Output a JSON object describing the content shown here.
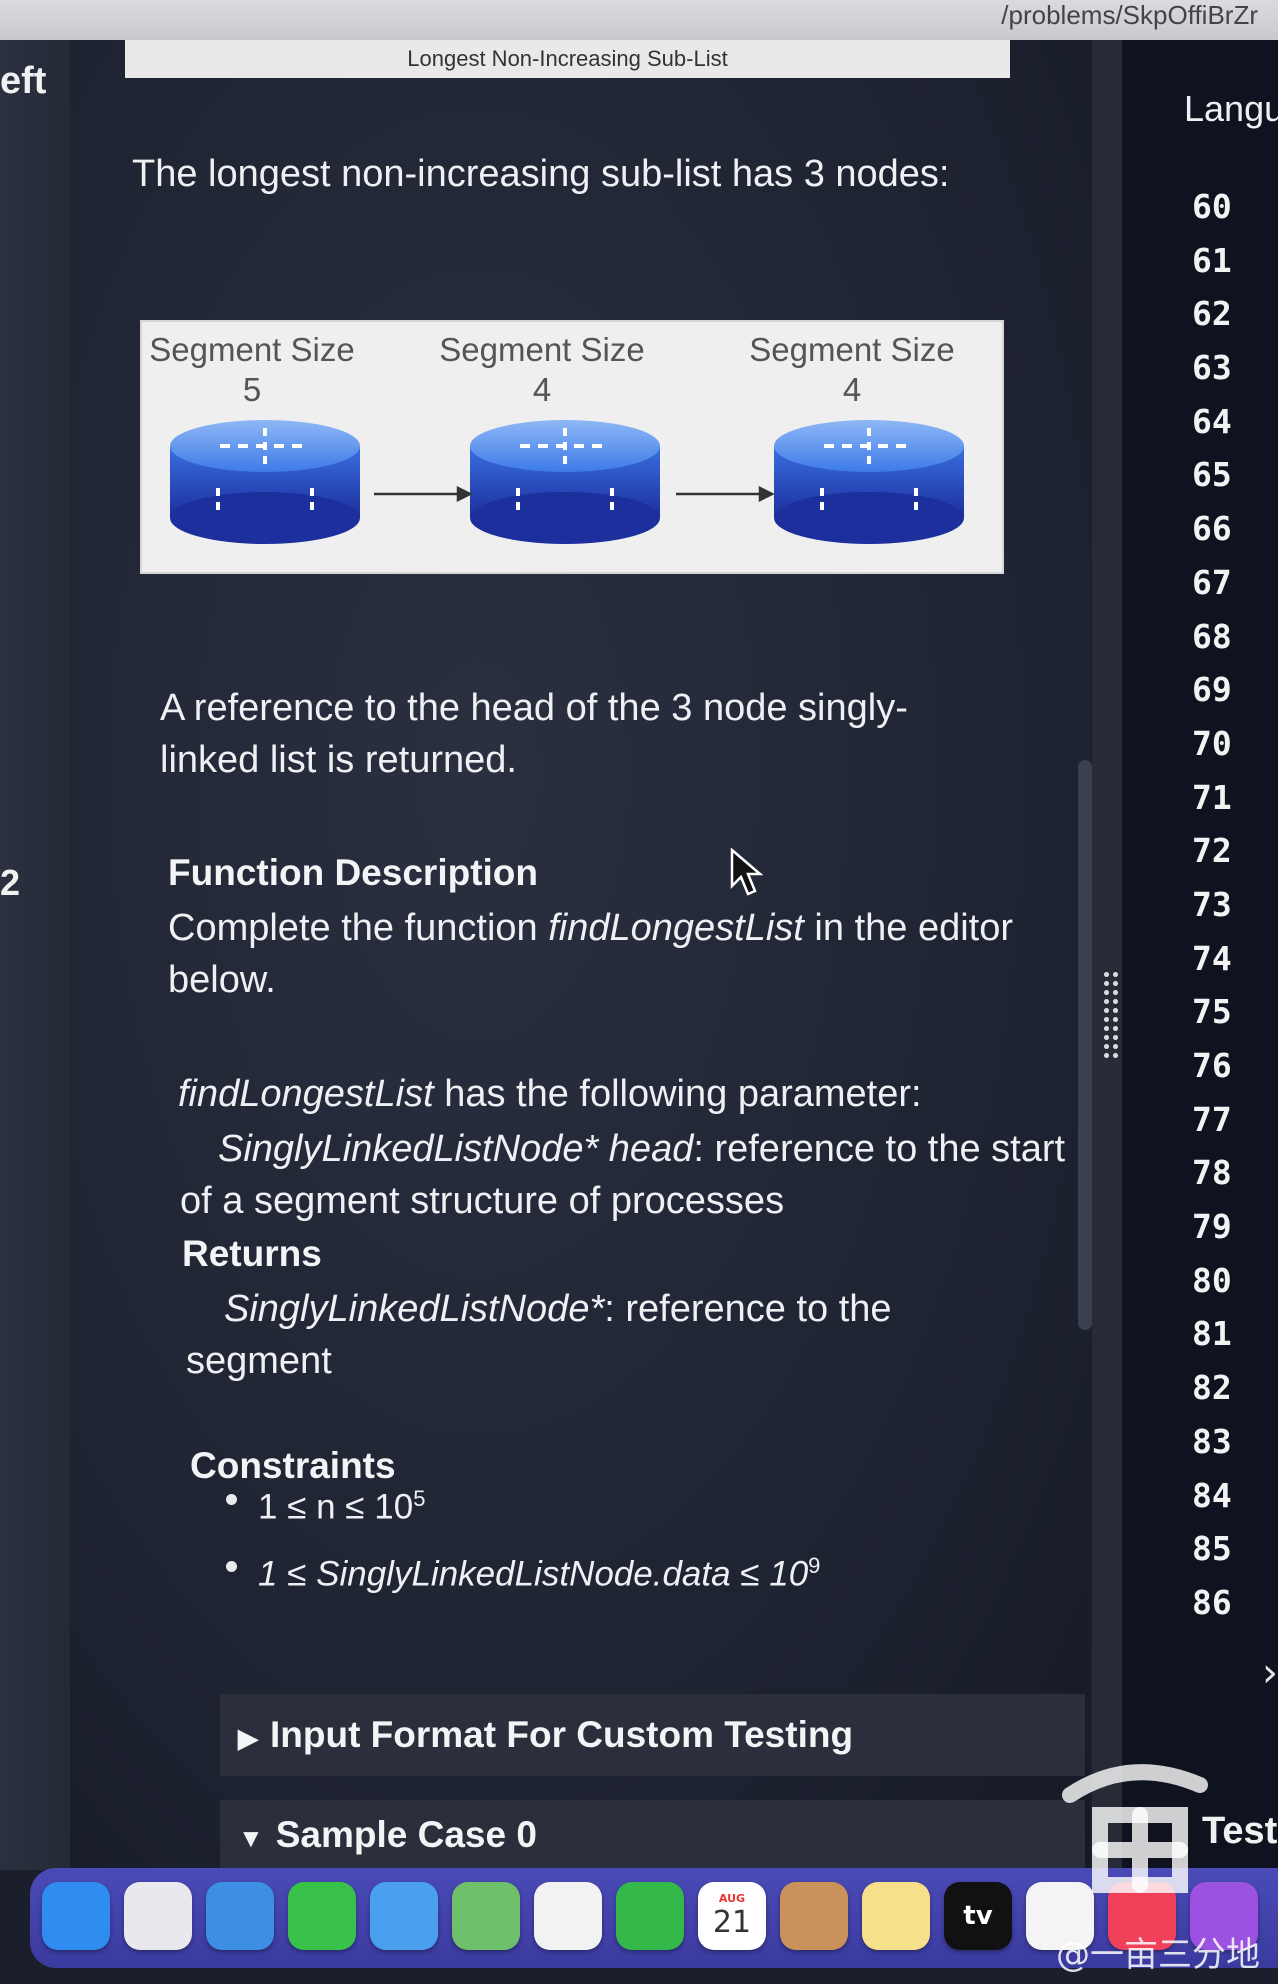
{
  "topbar": {
    "url_fragment": "/problems/SkpOffiBrZr"
  },
  "left_strip": {
    "fragments": [
      "eft",
      "2"
    ]
  },
  "figure": {
    "caption": "Longest Non-Increasing Sub-List",
    "segments": [
      {
        "label": "Segment Size",
        "size": "5"
      },
      {
        "label": "Segment Size",
        "size": "4"
      },
      {
        "label": "Segment Size",
        "size": "4"
      }
    ]
  },
  "problem": {
    "intro": "The longest non-increasing sub-list has 3 nodes:",
    "result": "A reference to the head of the 3 node singly-linked list is returned.",
    "function_description": {
      "heading": "Function Description",
      "text_before": "Complete the function ",
      "function_name": "findLongestList",
      "text_after": " in the editor below."
    },
    "parameter": {
      "function_name": "findLongestList",
      "intro_after": " has the following parameter:",
      "param_name": "SinglyLinkedListNode* head",
      "param_desc": ": reference to the start of a segment structure of processes"
    },
    "returns": {
      "heading": "Returns",
      "type": "SinglyLinkedListNode*",
      "desc": ": reference to the segment"
    },
    "constraints": {
      "heading": "Constraints",
      "items": [
        {
          "text": "1 ≤ n ≤ 10",
          "sup": "5"
        },
        {
          "text": "1 ≤ SinglyLinkedListNode.data ≤ 10",
          "sup": "9"
        }
      ]
    },
    "sections": [
      {
        "label": "Input Format For Custom Testing",
        "state": "collapsed",
        "marker": "▶"
      },
      {
        "label": "Sample Case 0",
        "state": "expanded",
        "marker": "▼"
      }
    ]
  },
  "editor": {
    "language_label": "Langu",
    "line_numbers": [
      "60",
      "61",
      "62",
      "63",
      "64",
      "65",
      "66",
      "67",
      "68",
      "69",
      "70",
      "71",
      "72",
      "73",
      "74",
      "75",
      "76",
      "77",
      "78",
      "79",
      "80",
      "81",
      "82",
      "83",
      "84",
      "85",
      "86"
    ],
    "test_label": "Test"
  },
  "dock": {
    "apps": [
      {
        "name": "Finder",
        "icon": "finder-icon",
        "color": "#2f8cf0"
      },
      {
        "name": "Launchpad",
        "icon": "launchpad-icon",
        "color": "#e8e8ee"
      },
      {
        "name": "Safari",
        "icon": "safari-icon",
        "color": "#3d8fe6"
      },
      {
        "name": "Messages",
        "icon": "messages-icon",
        "color": "#38c24a"
      },
      {
        "name": "Mail",
        "icon": "mail-icon",
        "color": "#4aa0ef"
      },
      {
        "name": "Maps",
        "icon": "maps-icon",
        "color": "#6fc06a"
      },
      {
        "name": "Photos",
        "icon": "photos-icon",
        "color": "#f2f2f2"
      },
      {
        "name": "FaceTime",
        "icon": "facetime-icon",
        "color": "#35b84a"
      },
      {
        "name": "Calendar",
        "icon": "calendar-icon",
        "color": "#ffffff",
        "month": "AUG",
        "day": "21"
      },
      {
        "name": "Contacts",
        "icon": "contacts-icon",
        "color": "#c9925a"
      },
      {
        "name": "Notes",
        "icon": "notes-icon",
        "color": "#f7e08a"
      },
      {
        "name": "Apple TV",
        "icon": "appletv-icon",
        "color": "#111111",
        "label": "tv"
      },
      {
        "name": "Reminders",
        "icon": "reminders-icon",
        "color": "#f4f4f4"
      },
      {
        "name": "Music",
        "icon": "music-icon",
        "color": "#f0405a"
      },
      {
        "name": "Podcasts",
        "icon": "podcasts-icon",
        "color": "#9b52e0"
      }
    ]
  },
  "watermark": {
    "text": "@一亩三分地"
  }
}
